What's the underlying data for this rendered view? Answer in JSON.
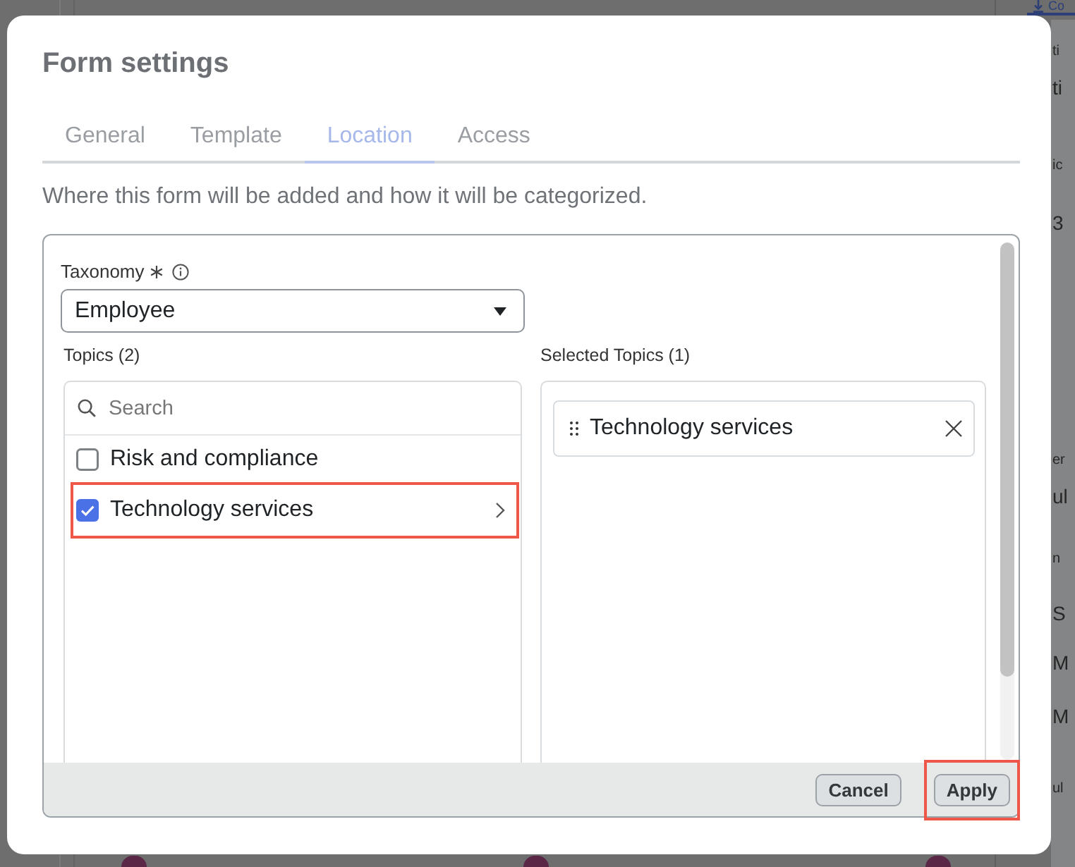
{
  "dialog": {
    "title": "Form settings",
    "tabs": [
      {
        "label": "General",
        "selected": false
      },
      {
        "label": "Template",
        "selected": false
      },
      {
        "label": "Location",
        "selected": true
      },
      {
        "label": "Access",
        "selected": false
      }
    ],
    "description": "Where this form will be added and how it will be categorized.",
    "taxonomy": {
      "label": "Taxonomy",
      "required": true,
      "value": "Employee"
    },
    "topics": {
      "label": "Topics (2)",
      "search": {
        "placeholder": "Search"
      },
      "items": [
        {
          "label": "Risk and compliance",
          "checked": false,
          "expandable": false,
          "highlighted": false
        },
        {
          "label": "Technology services",
          "checked": true,
          "expandable": true,
          "highlighted": true
        }
      ]
    },
    "selected_topics": {
      "label": "Selected Topics (1)",
      "items": [
        {
          "label": "Technology services"
        }
      ]
    },
    "buttons": [
      {
        "label": "Cancel",
        "highlighted": false
      },
      {
        "label": "Apply",
        "highlighted": true
      }
    ]
  },
  "background_page": {
    "tab": {
      "label": "Co",
      "selected": true
    },
    "rows": [
      {
        "kind": "label",
        "text": "ti"
      },
      {
        "kind": "value",
        "text": "ti"
      },
      {
        "kind": "label",
        "text": "ic"
      },
      {
        "kind": "value",
        "text": "3"
      },
      {
        "kind": "label",
        "text": "er"
      },
      {
        "kind": "value",
        "text": "ul"
      },
      {
        "kind": "label",
        "text": "n"
      },
      {
        "kind": "value",
        "text": "S"
      },
      {
        "kind": "value",
        "text": "M"
      },
      {
        "kind": "value",
        "text": "M"
      },
      {
        "kind": "label",
        "text": "ul"
      }
    ]
  }
}
